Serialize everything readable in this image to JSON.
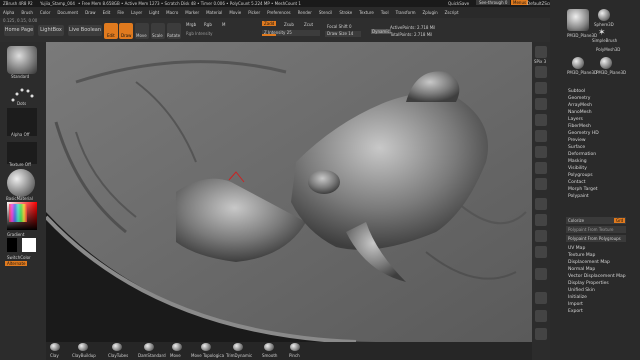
{
  "titlebar": {
    "app": "ZBrush 4R8 P2",
    "doc": "Yujiia_Stamp_004",
    "stats": "• Free Mem 8.658GB • Active Mem 1273 • Scratch Disk 48 • Timer 0.006 • PolyCount 5.224 MP • MeshCount 1",
    "quicksave": "QuickSave",
    "see_through": "See-through 0",
    "menus_label": "Menus",
    "default_script": "DefaultZScript"
  },
  "menu": [
    "Alpha",
    "Brush",
    "Color",
    "Document",
    "Draw",
    "Edit",
    "File",
    "Layer",
    "Light",
    "Macro",
    "Marker",
    "Material",
    "Movie",
    "Picker",
    "Preferences",
    "Render",
    "Stencil",
    "Stroke",
    "Texture",
    "Tool",
    "Transform",
    "Zplugin",
    "Zscript"
  ],
  "coords": "0.125, 0.15, 0.00",
  "topshelf": {
    "home": "Home Page",
    "lightbox": "LightBox",
    "liveboolean": "Live Boolean",
    "edit": "Edit",
    "draw": "Draw",
    "move": "Move",
    "scale": "Scale",
    "rotate": "Rotate",
    "mrgb": "Mrgb",
    "rgb": "Rgb",
    "m": "M",
    "zadd": "Zadd",
    "zsub": "Zsub",
    "zcut": "Zcut",
    "rgb_intensity": "Rgb Intensity",
    "z_intensity": "Z Intensity 25",
    "focal_shift": "Focal Shift 0",
    "draw_size": "Draw Size 14",
    "dynamic": "Dynamic",
    "active_points": "ActivePoints: 2.718 Mil",
    "total_points": "TotalPoints: 2.718 Mil"
  },
  "leftshelf": {
    "standard": "Standard",
    "dots": "Dots",
    "alpha_off": "Alpha Off",
    "texture_off": "Texture Off",
    "basic_material": "BasicMaterial",
    "gradient": "Gradient",
    "switch_color": "SwitchColor",
    "alternate": "Alternate"
  },
  "bottombrushes": [
    "Clay",
    "ClayBuildup",
    "ClayTubes",
    "DamStandard",
    "Move",
    "Move Topologica",
    "TrimDynamic",
    "Smooth",
    "Pinch"
  ],
  "righttools": [
    "SPix 3",
    "Scroll",
    "Zoom",
    "Actual",
    "AAHalf",
    "Persp",
    "Floor",
    "Local",
    "XYZ",
    "Frame",
    "Move",
    "Scale",
    "Rotate",
    "PolyF",
    "Transp",
    "Solo",
    "Dynamic"
  ],
  "rightpanel": {
    "tools": [
      {
        "name": "Sphere3D",
        "label": "Sphere3D"
      },
      {
        "name": "SimpleBrush",
        "label": "SimpleBrush"
      },
      {
        "name": "PM3D_Plane3D_1",
        "label": "PM3D_Plane3D"
      },
      {
        "name": "PolyMesh3D",
        "label": "PolyMesh3D"
      },
      {
        "name": "PM3D_Plane3D_2",
        "label": "PM3D_Plane3D"
      },
      {
        "name": "PM3D_Plane3D_3",
        "label": "PM3D_Plane3D"
      }
    ],
    "items1": [
      "Subtool",
      "Geometry",
      "ArrayMesh",
      "NanoMesh",
      "Layers",
      "FiberMesh",
      "Geometry HD",
      "Preview",
      "Surface",
      "Deformation",
      "Masking",
      "Visibility",
      "Polygroups",
      "Contact",
      "Morph Target",
      "Polypaint",
      "UV Map",
      "Texture Map",
      "Displacement Map",
      "Normal Map",
      "Vector Displacement Map",
      "Display Properties",
      "Unified Skin",
      "Initialize",
      "Import",
      "Export"
    ],
    "colorize": "Colorize",
    "grd": "Grd",
    "polypaint_from_texture": "Polypaint From Texture",
    "polypaint_from_polygroups": "Polypaint From Polygroups"
  },
  "colors": {
    "accent": "#e07a1e",
    "panel": "#2a2a2a",
    "canvas": "#6b6b6b"
  }
}
